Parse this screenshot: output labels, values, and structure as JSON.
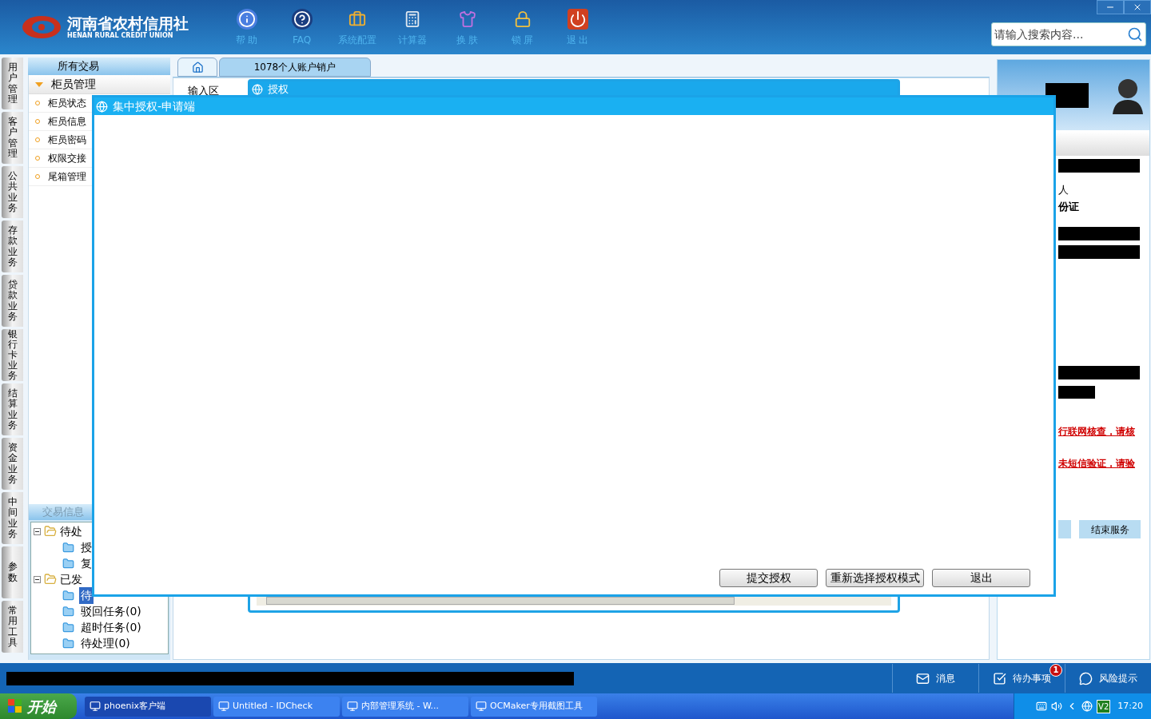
{
  "header": {
    "logo_cn": "河南省农村信用社",
    "logo_en": "HENAN RURAL CREDIT UNION",
    "toolbar": [
      {
        "label": "帮 助"
      },
      {
        "label": "FAQ"
      },
      {
        "label": "系统配置"
      },
      {
        "label": "计算器"
      },
      {
        "label": "换 肤"
      },
      {
        "label": "锁 屏"
      },
      {
        "label": "退 出"
      }
    ],
    "search": {
      "placeholder": "请输入搜索内容..."
    }
  },
  "side_tabs": [
    "用户管理",
    "客户管理",
    "公共业务",
    "存款业务",
    "贷款业务",
    "银行卡业务",
    "结算业务",
    "资金业务",
    "中间业务",
    "参数",
    "常用工具"
  ],
  "sidebar": {
    "title": "所有交易",
    "group": {
      "label": "柜员管理",
      "expanded": true
    },
    "items": [
      "柜员状态",
      "柜员信息",
      "柜员密码",
      "权限交接",
      "尾箱管理"
    ]
  },
  "trade_info": {
    "title": "交易信息",
    "tree": [
      {
        "label": "待处",
        "children": [
          {
            "label": "授",
            "selected": false
          },
          {
            "label": "复",
            "selected": false
          }
        ]
      },
      {
        "label": "已发",
        "children": [
          {
            "label": "待",
            "selected": true
          },
          {
            "label": "驳回任务(0)",
            "selected": false
          },
          {
            "label": "超时任务(0)",
            "selected": false
          },
          {
            "label": "待处理(0)",
            "selected": false
          }
        ]
      }
    ]
  },
  "tabs": [
    {
      "kind": "home",
      "selected": false
    },
    {
      "kind": "text",
      "label": "1078个人账户销户",
      "selected": true
    }
  ],
  "input_area": {
    "label": "输入区"
  },
  "auth_window": {
    "title": "授权"
  },
  "dialog": {
    "title": "集中授权-申请端",
    "buttons": [
      "提交授权",
      "重新选择授权模式",
      "退出"
    ]
  },
  "right_panel": {
    "lines": [
      {
        "kind": "redacted"
      },
      {
        "kind": "text",
        "text": "人"
      },
      {
        "kind": "bold",
        "text": "份证"
      },
      {
        "kind": "redacted"
      },
      {
        "kind": "redacted"
      },
      {
        "kind": "redacted"
      },
      {
        "kind": "redacted_short"
      },
      {
        "kind": "warning",
        "text": "行联网核查，请核"
      },
      {
        "kind": "warning",
        "text": "未短信验证，请验"
      }
    ],
    "button": "结束服务"
  },
  "status_bar": {
    "items": [
      {
        "kind": "message",
        "label": "消息"
      },
      {
        "kind": "todo",
        "label": "待办事项",
        "badge": "1"
      },
      {
        "kind": "risk",
        "label": "风险提示"
      }
    ]
  },
  "taskbar": {
    "start": "开始",
    "tasks": [
      {
        "label": "phoenix客户端",
        "selected": true
      },
      {
        "label": "Untitled - IDCheck",
        "selected": false
      },
      {
        "label": "内部管理系统 - W...",
        "selected": false
      },
      {
        "label": "OCMaker专用截图工具",
        "selected": false
      }
    ],
    "tray_badge": "V2",
    "time": "17:20"
  }
}
